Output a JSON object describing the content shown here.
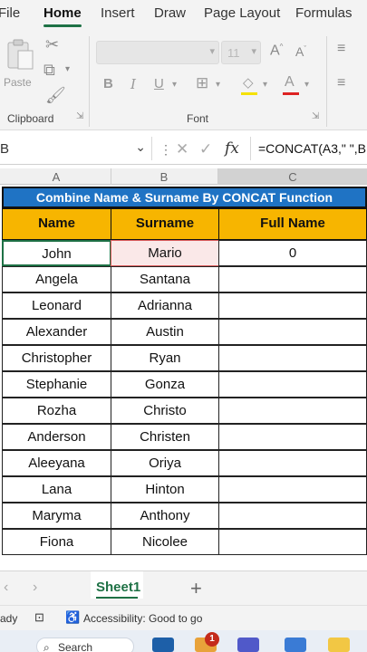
{
  "ribbon_tabs": [
    "File",
    "Home",
    "Insert",
    "Draw",
    "Page Layout",
    "Formulas"
  ],
  "ribbon": {
    "clipboard": {
      "paste_label": "Paste",
      "group_label": "Clipboard"
    },
    "font": {
      "font_size": "11",
      "group_label": "Font"
    }
  },
  "formula_bar": {
    "name_box": "B",
    "fx_label": "fx",
    "formula": "=CONCAT(A3,\" \",B"
  },
  "columns": [
    "A",
    "B",
    "C"
  ],
  "table": {
    "title": "Combine Name & Surname By CONCAT Function",
    "headers": [
      "Name",
      "Surname",
      "Full Name"
    ],
    "rows": [
      {
        "name": "John",
        "surname": "Mario",
        "full": "0"
      },
      {
        "name": "Angela",
        "surname": "Santana",
        "full": ""
      },
      {
        "name": "Leonard",
        "surname": "Adrianna",
        "full": ""
      },
      {
        "name": "Alexander",
        "surname": "Austin",
        "full": ""
      },
      {
        "name": "Christopher",
        "surname": "Ryan",
        "full": ""
      },
      {
        "name": "Stephanie",
        "surname": "Gonza",
        "full": ""
      },
      {
        "name": "Rozha",
        "surname": "Christo",
        "full": ""
      },
      {
        "name": "Anderson",
        "surname": "Christen",
        "full": ""
      },
      {
        "name": "Aleeyana",
        "surname": "Oriya",
        "full": ""
      },
      {
        "name": "Lana",
        "surname": "Hinton",
        "full": ""
      },
      {
        "name": "Maryma",
        "surname": "Anthony",
        "full": ""
      },
      {
        "name": "Fiona",
        "surname": "Nicolee",
        "full": ""
      }
    ]
  },
  "sheet_tabs": {
    "active": "Sheet1",
    "add_label": "+"
  },
  "status_bar": {
    "ready": "ady",
    "accessibility": "Accessibility: Good to go"
  },
  "taskbar": {
    "search": "Search",
    "badge_count": "1"
  },
  "colors": {
    "title_bg": "#1f73c4",
    "header_bg": "#f7b500",
    "accent": "#1e7145"
  }
}
